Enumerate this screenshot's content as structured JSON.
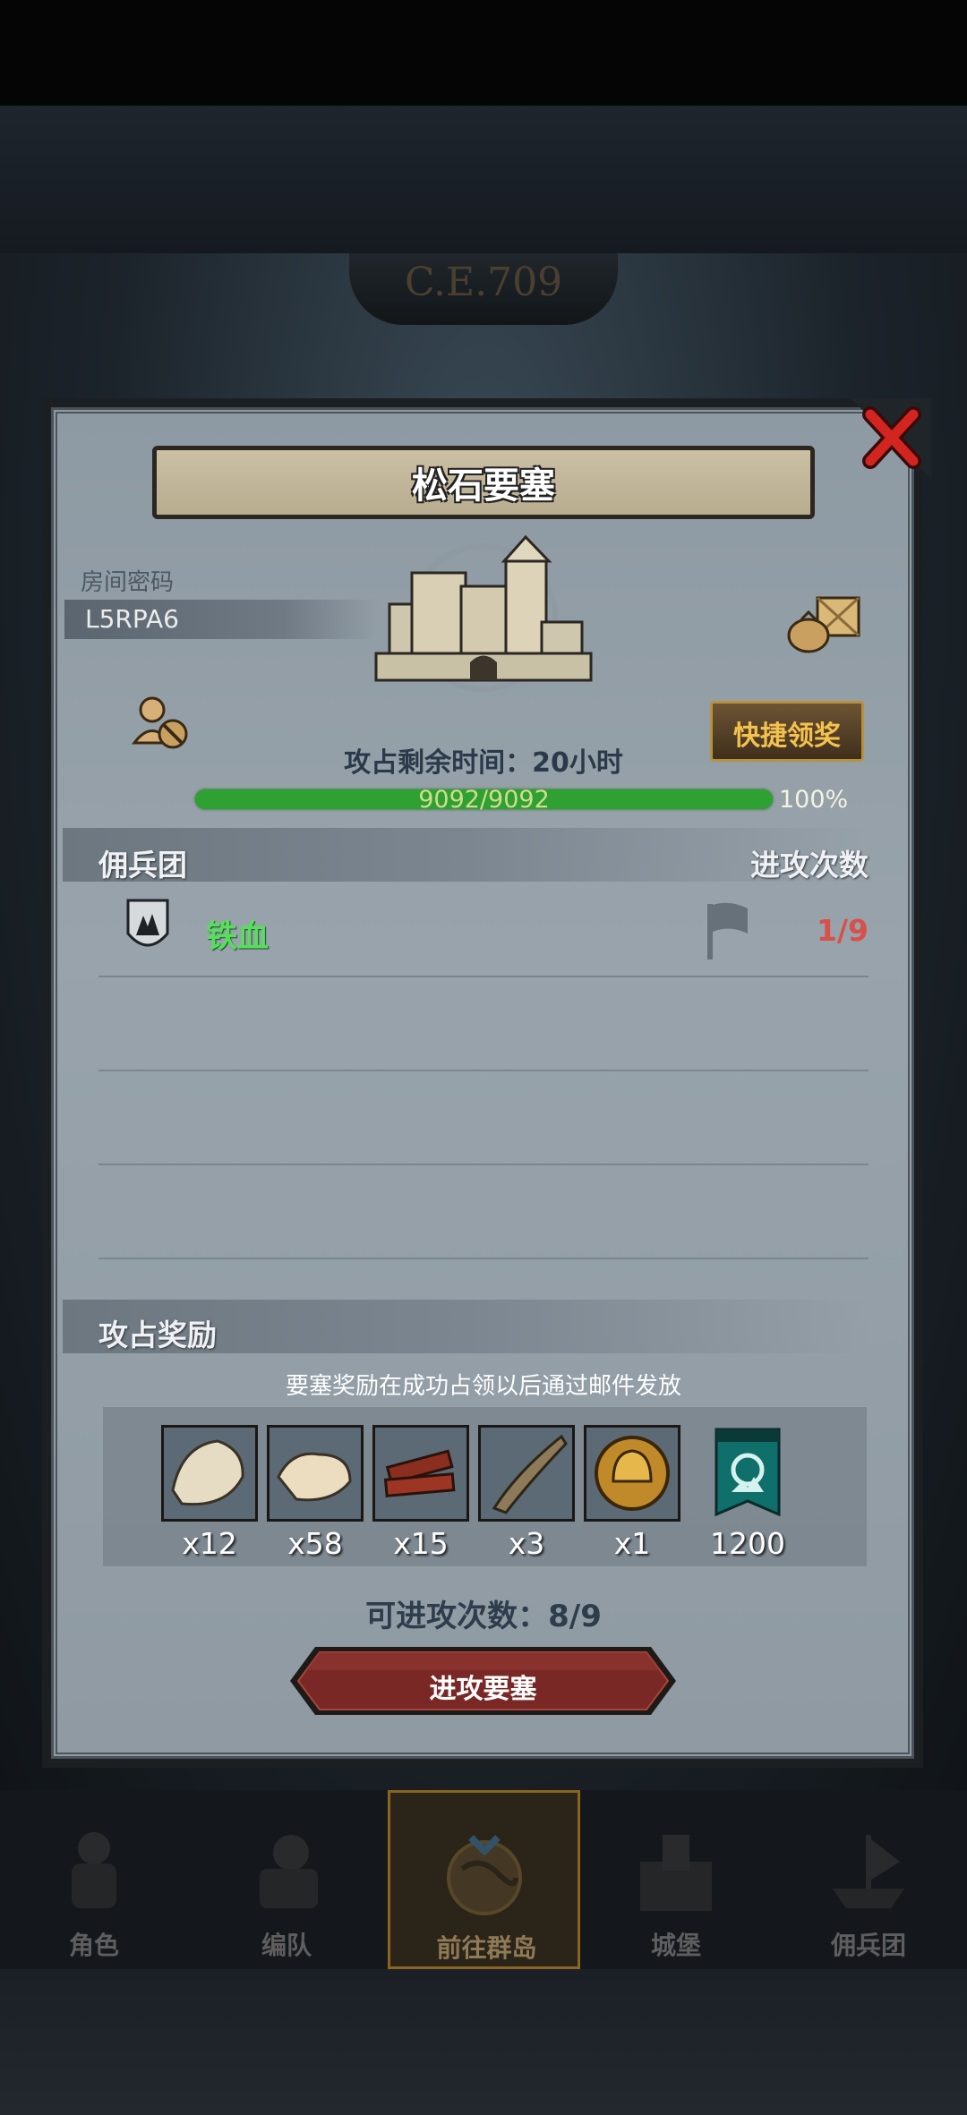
{
  "background": {
    "era_label": "C.E.709"
  },
  "dialog": {
    "title": "松石要塞",
    "room_password_label": "房间密码",
    "room_password": "L5RPA6",
    "quick_claim_label": "快捷领奖",
    "time_remaining": "攻占剩余时间：20小时",
    "hp_text": "9092/9092",
    "hp_percent_text": "100%",
    "hp_fraction": 1.0,
    "mercenary_header": "佣兵团",
    "attack_count_header": "进攻次数",
    "guilds": [
      {
        "name": "铁血",
        "attacks": "1/9"
      }
    ],
    "reward_header": "攻占奖励",
    "reward_note": "要塞奖励在成功占领以后通过邮件发放",
    "rewards": [
      {
        "icon": "fur-pelt-icon",
        "count": "x12"
      },
      {
        "icon": "wool-icon",
        "count": "x58"
      },
      {
        "icon": "wood-planks-icon",
        "count": "x15"
      },
      {
        "icon": "horn-icon",
        "count": "x3"
      },
      {
        "icon": "gold-helmet-coin-icon",
        "count": "x1"
      },
      {
        "icon": "guild-banner-icon",
        "count": "1200"
      }
    ],
    "remaining_attacks": "可进攻次数：8/9",
    "attack_button_label": "进攻要塞"
  },
  "bottom_nav": [
    {
      "label": "角色",
      "icon": "knight-icon"
    },
    {
      "label": "编队",
      "icon": "formation-icon"
    },
    {
      "label": "前往群岛",
      "icon": "globe-icon",
      "active": true
    },
    {
      "label": "城堡",
      "icon": "castle-icon"
    },
    {
      "label": "佣兵团",
      "icon": "mercenary-ship-icon"
    }
  ],
  "colors": {
    "guild_name": "#56e05a",
    "attack_count": "#d8504a",
    "quick_claim_text": "#f3c24f",
    "hp_bar": "#2fa032"
  }
}
